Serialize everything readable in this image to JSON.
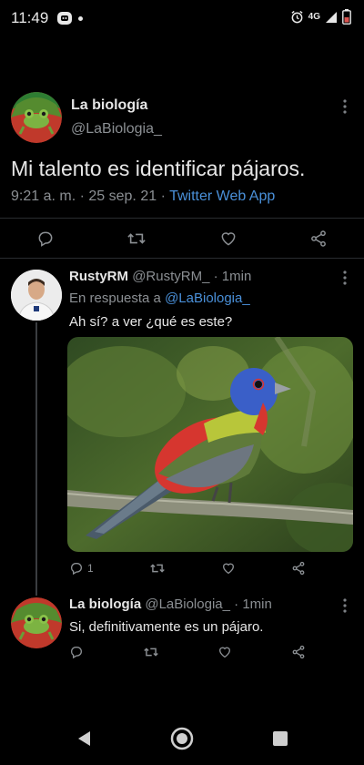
{
  "status_bar": {
    "time": "11:49",
    "network": "4G"
  },
  "main_tweet": {
    "author_name": "La biología",
    "author_handle": "@LaBiologia_",
    "text": "Mi talento es identificar pájaros.",
    "time": "9:21 a. m.",
    "date": "25 sep. 21",
    "source": "Twitter Web App",
    "separator": "·"
  },
  "reply_1": {
    "author_name": "RustyRM",
    "author_handle": "@RustyRM_",
    "separator": "·",
    "time": "1min",
    "reply_prefix": "En respuesta a",
    "reply_to": "@LaBiologia_",
    "text": "Ah sí? a ver ¿qué es este?",
    "reply_count": "1"
  },
  "reply_2": {
    "author_name": "La biología",
    "author_handle": "@LaBiologia_",
    "separator": "·",
    "time": "1min",
    "text": "Si, definitivamente es un pájaro."
  },
  "icons": [
    "reply-icon",
    "retweet-icon",
    "like-icon",
    "share-icon",
    "more-icon",
    "back-icon",
    "home-icon",
    "recents-icon",
    "alarm-icon",
    "signal-icon",
    "battery-icon"
  ],
  "colors": {
    "background": "#000000",
    "link": "#4a90d9",
    "muted": "#8b8f93"
  }
}
